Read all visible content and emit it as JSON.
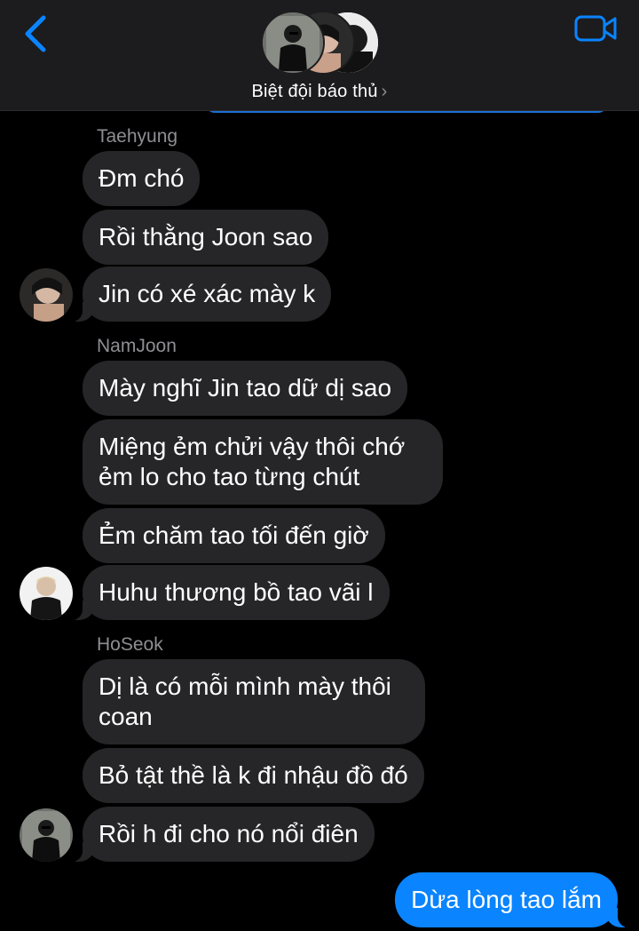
{
  "header": {
    "group_name": "Biệt đội báo thủ",
    "chevron": "›",
    "icons": {
      "back": "chevron-left-icon",
      "video": "video-camera-icon"
    },
    "accent_color": "#0a84ff"
  },
  "messages": [
    {
      "sender": "Taehyung",
      "bubbles": [
        "Đm chó",
        "Rồi thằng Joon sao",
        "Jin có xé xác mày k"
      ]
    },
    {
      "sender": "NamJoon",
      "bubbles": [
        "Mày nghĩ Jin tao dữ dị sao",
        "Miệng ẻm chửi vậy thôi chớ ẻm lo cho tao từng chút",
        "Ẻm chăm tao tối đến giờ",
        "Huhu thương bồ tao vãi l"
      ]
    },
    {
      "sender": "HoSeok",
      "bubbles": [
        "Dị là có mỗi mình mày thôi coan",
        "Bỏ tật thề là k đi nhậu đồ đó",
        "Rồi h đi cho nó nổi điên"
      ]
    }
  ],
  "outgoing": [
    "Dừa lòng tao lắm"
  ],
  "colors": {
    "incoming_bubble": "#262628",
    "outgoing_bubble": "#0a84ff",
    "background": "#000000"
  }
}
